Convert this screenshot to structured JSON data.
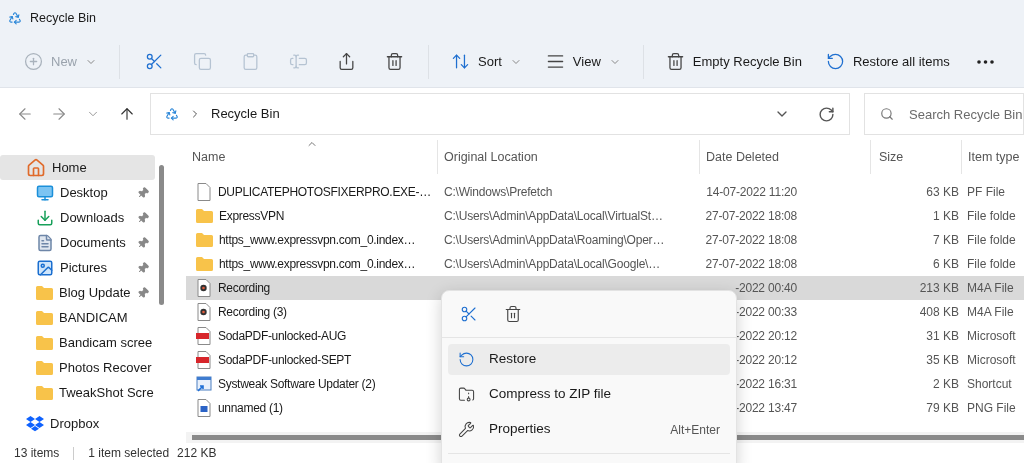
{
  "window": {
    "title": "Recycle Bin"
  },
  "toolbar": [
    {
      "kind": "new",
      "label": "New",
      "disabled": true,
      "dropdown": true
    },
    {
      "kind": "separator"
    },
    {
      "kind": "cut",
      "disabled": false
    },
    {
      "kind": "copy",
      "disabled": true
    },
    {
      "kind": "paste",
      "disabled": true
    },
    {
      "kind": "rename",
      "disabled": true
    },
    {
      "kind": "share",
      "disabled": false
    },
    {
      "kind": "delete",
      "disabled": false
    },
    {
      "kind": "separator"
    },
    {
      "kind": "sort",
      "label": "Sort",
      "disabled": false,
      "dropdown": true
    },
    {
      "kind": "view",
      "label": "View",
      "disabled": false,
      "dropdown": true
    },
    {
      "kind": "separator"
    },
    {
      "kind": "empty",
      "label": "Empty Recycle Bin",
      "disabled": false
    },
    {
      "kind": "restore_all",
      "label": "Restore all items",
      "disabled": false
    },
    {
      "kind": "more",
      "disabled": false
    }
  ],
  "navigation": [
    {
      "kind": "back",
      "disabled": true
    },
    {
      "kind": "forward",
      "disabled": true
    },
    {
      "kind": "recent",
      "disabled": true
    },
    {
      "kind": "up",
      "disabled": false
    }
  ],
  "address": {
    "path": "Recycle Bin"
  },
  "search": {
    "placeholder": "Search Recycle Bin"
  },
  "sidebar": {
    "items": [
      {
        "kind": "home",
        "label": "Home",
        "selected": true,
        "pinned": false
      },
      {
        "kind": "desktop",
        "label": "Desktop",
        "selected": false,
        "pinned": true
      },
      {
        "kind": "downloads",
        "label": "Downloads",
        "selected": false,
        "pinned": true
      },
      {
        "kind": "documents",
        "label": "Documents",
        "selected": false,
        "pinned": true
      },
      {
        "kind": "pictures",
        "label": "Pictures",
        "selected": false,
        "pinned": true
      },
      {
        "kind": "folder",
        "label": "Blog Update",
        "selected": false,
        "pinned": true
      },
      {
        "kind": "folder",
        "label": "BANDICAM",
        "selected": false,
        "pinned": false
      },
      {
        "kind": "folder",
        "label": "Bandicam scree",
        "selected": false,
        "pinned": false
      },
      {
        "kind": "folder",
        "label": "Photos Recover",
        "selected": false,
        "pinned": false
      },
      {
        "kind": "folder",
        "label": "TweakShot Scre",
        "selected": false,
        "pinned": false
      },
      {
        "kind": "dropbox",
        "label": "Dropbox",
        "selected": false,
        "pinned": false
      }
    ]
  },
  "table": {
    "columns": [
      {
        "label": "Name",
        "sorted": true
      },
      {
        "label": "Original Location",
        "sorted": false
      },
      {
        "label": "Date Deleted",
        "sorted": false
      },
      {
        "label": "Size",
        "sorted": false
      },
      {
        "label": "Item type",
        "sorted": false
      }
    ],
    "rows": [
      {
        "kind": "file",
        "name": "DUPLICATEPHOTOSFIXERPRO.EXE-…",
        "location": "C:\\Windows\\Prefetch",
        "date": "14-07-2022 11:20",
        "size": "63 KB",
        "type": "PF File",
        "selected": false
      },
      {
        "kind": "folder",
        "name": "ExpressVPN",
        "location": "C:\\Users\\Admin\\AppData\\Local\\VirtualSt…",
        "date": "27-07-2022 18:08",
        "size": "1 KB",
        "type": "File folde",
        "selected": false
      },
      {
        "kind": "folder",
        "name": "https_www.expressvpn.com_0.index…",
        "location": "C:\\Users\\Admin\\AppData\\Roaming\\Oper…",
        "date": "27-07-2022 18:08",
        "size": "7 KB",
        "type": "File folde",
        "selected": false
      },
      {
        "kind": "folder",
        "name": "https_www.expressvpn.com_0.index…",
        "location": "C:\\Users\\Admin\\AppData\\Local\\Google\\…",
        "date": "27-07-2022 18:08",
        "size": "6 KB",
        "type": "File folde",
        "selected": false
      },
      {
        "kind": "audio",
        "name": "Recording",
        "date": "-2022 00:40",
        "size": "213 KB",
        "type": "M4A File",
        "selected": true
      },
      {
        "kind": "audio",
        "name": "Recording (3)",
        "date": "-2022 00:33",
        "size": "408 KB",
        "type": "M4A File",
        "selected": false
      },
      {
        "kind": "pdf",
        "name": "SodaPDF-unlocked-AUG",
        "date": "-2022 20:12",
        "size": "31 KB",
        "type": "Microsoft",
        "selected": false
      },
      {
        "kind": "pdf",
        "name": "SodaPDF-unlocked-SEPT",
        "date": "-2022 20:12",
        "size": "35 KB",
        "type": "Microsoft",
        "selected": false
      },
      {
        "kind": "shortcut",
        "name": "Systweak Software Updater (2)",
        "date": "-2022 16:31",
        "size": "2 KB",
        "type": "Shortcut",
        "selected": false
      },
      {
        "kind": "image",
        "name": "unnamed (1)",
        "date": "-2022 13:47",
        "size": "79 KB",
        "type": "PNG File",
        "selected": false
      }
    ]
  },
  "context_menu": {
    "actions": [
      {
        "kind": "cut"
      },
      {
        "kind": "delete"
      }
    ],
    "items": [
      {
        "kind": "restore",
        "label": "Restore",
        "selected": true
      },
      {
        "kind": "zip",
        "label": "Compress to ZIP file",
        "selected": false
      },
      {
        "kind": "properties",
        "label": "Properties",
        "shortcut": "Alt+Enter",
        "selected": false
      }
    ]
  },
  "status_bar": {
    "count": "13 items",
    "selection": "1 item selected",
    "size": "212 KB"
  }
}
